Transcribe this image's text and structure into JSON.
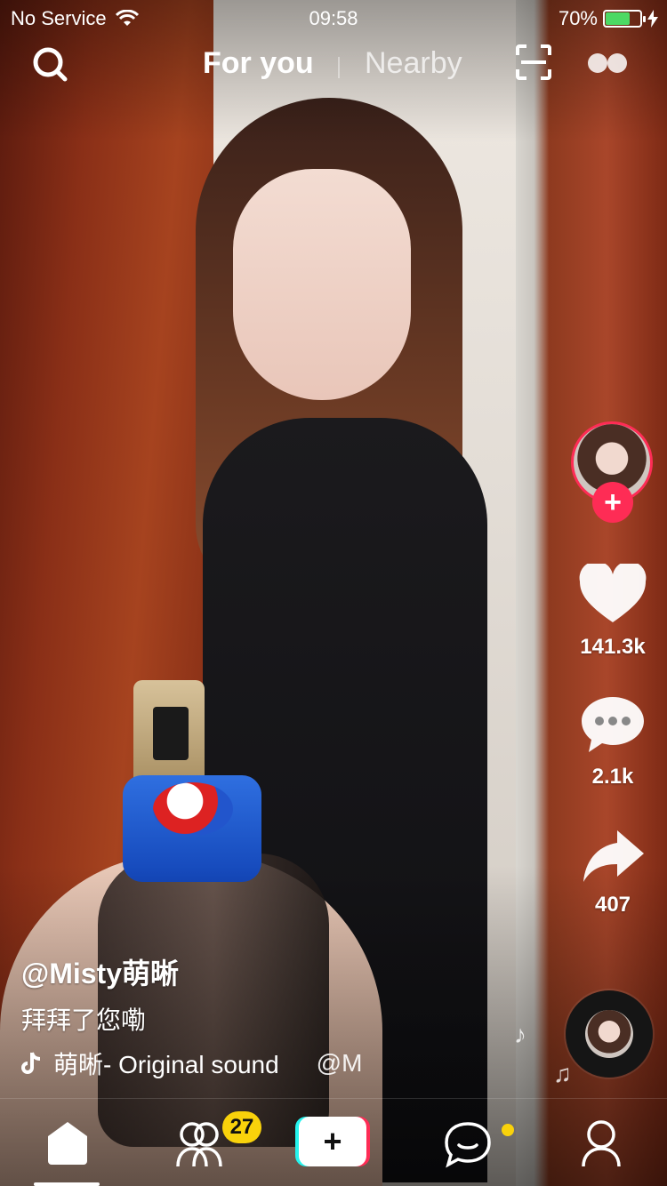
{
  "status_bar": {
    "carrier": "No Service",
    "time": "09:58",
    "battery": "70%",
    "battery_level": 0.7
  },
  "top_nav": {
    "tabs": [
      {
        "label": "For you",
        "active": true
      },
      {
        "label": "Nearby",
        "active": false
      }
    ]
  },
  "actions": {
    "likes": "141.3k",
    "comments": "2.1k",
    "shares": "407"
  },
  "video": {
    "username": "@Misty萌晰",
    "caption": "拜拜了您嘞",
    "sound": "萌晰- Original sound",
    "sound_mention": "@M"
  },
  "tab_bar": {
    "friends_badge": "27",
    "create_label": "+"
  },
  "colors": {
    "accent": "#fe2c55",
    "cyan": "#25f4ee",
    "badge": "#f9d20b",
    "battery_fill": "#4cd964"
  }
}
